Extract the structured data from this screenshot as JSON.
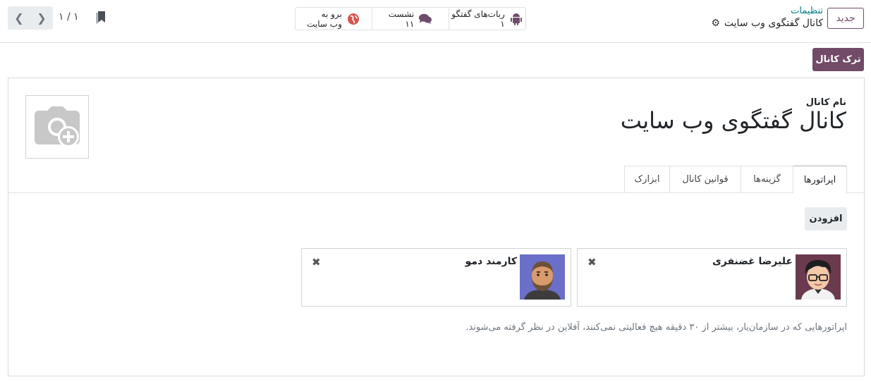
{
  "control_panel": {
    "new_button": "جدید",
    "breadcrumb_parent": "تنظیمات",
    "breadcrumb_current": "کانال گفتگوی وب سایت",
    "stats": [
      {
        "label": "ربات‌های گفتگو",
        "value": "۱",
        "icon": "android-icon"
      },
      {
        "label": "نشست",
        "value": "۱۱",
        "icon": "comments-icon"
      },
      {
        "label": "برو به",
        "value": "وب سایت",
        "icon": "globe-icon"
      }
    ],
    "pager": "۱ / ۱"
  },
  "form": {
    "leave_channel_button": "ترک کانال",
    "channel_name_label": "نام کانال",
    "channel_name": "کانال گفتگوی وب سایت",
    "tabs": [
      "اپراتورها",
      "گزینه‌ها",
      "قوانین کانال",
      "ابزارک"
    ],
    "add_button": "افزودن",
    "operators": [
      {
        "name": "علیرضا غضنفری"
      },
      {
        "name": "کارمند دمو"
      }
    ],
    "help_text": "اپراتورهایی که در سازمان‌یار، بیشتر از ۳۰ دقیقه هیچ فعالیتی نمی‌کنند، آفلاین در نظر گرفته می‌شوند."
  },
  "colors": {
    "primary": "#714B67",
    "link": "#017e84",
    "border": "#dee2e6"
  }
}
